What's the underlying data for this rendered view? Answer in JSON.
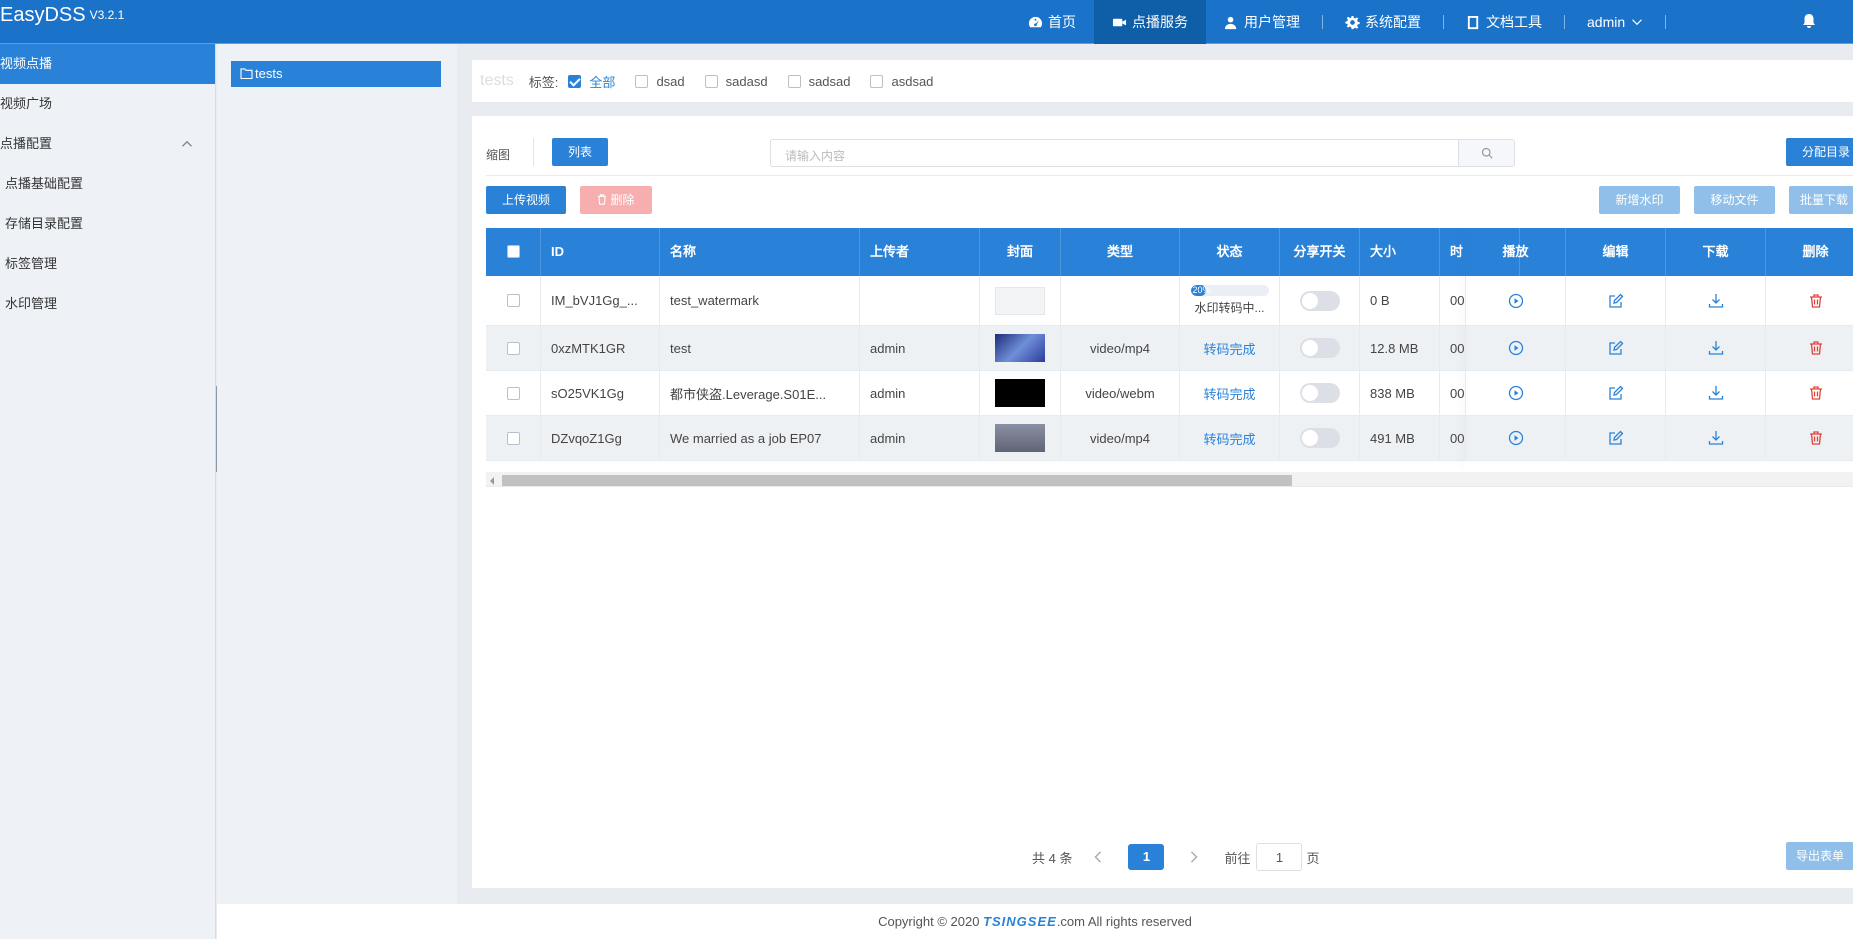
{
  "app": {
    "brand": "EasyDSS",
    "version": "V3.2.1"
  },
  "nav": {
    "home": "首页",
    "vod_service": "点播服务",
    "user_mgmt": "用户管理",
    "sys_config": "系统配置",
    "doc_tools": "文档工具",
    "user": "admin"
  },
  "sidebar": {
    "items": [
      {
        "label": "视频点播"
      },
      {
        "label": "视频广场"
      },
      {
        "label": "点播配置"
      },
      {
        "label": "点播基础配置"
      },
      {
        "label": "存储目录配置"
      },
      {
        "label": "标签管理"
      },
      {
        "label": "水印管理"
      }
    ]
  },
  "folder": {
    "name": "tests"
  },
  "tagbar": {
    "current": "tests",
    "label": "标签:",
    "tags": [
      {
        "label": "全部",
        "checked": true
      },
      {
        "label": "dsad",
        "checked": false
      },
      {
        "label": "sadasd",
        "checked": false
      },
      {
        "label": "sadsad",
        "checked": false
      },
      {
        "label": "asdsad",
        "checked": false
      }
    ]
  },
  "toolbar": {
    "view_thumb": "缩图",
    "view_list": "列表",
    "search_placeholder": "请输入内容",
    "assign_dir": "分配目录",
    "upload": "上传视频",
    "delete": "删除",
    "add_watermark": "新增水印",
    "move_file": "移动文件",
    "batch_download": "批量下载"
  },
  "table": {
    "headers": {
      "id": "ID",
      "name": "名称",
      "uploader": "上传者",
      "cover": "封面",
      "type": "类型",
      "status": "状态",
      "share": "分享开关",
      "size": "大小",
      "time": "时",
      "play": "播放",
      "edit": "编辑",
      "download": "下载",
      "remove": "删除"
    },
    "rows": [
      {
        "id": "IM_bVJ1Gg_...",
        "name": "test_watermark",
        "uploader": "",
        "type": "",
        "status": "水印转码中...",
        "progress": 20,
        "progress_label": "20%",
        "size": "0 B",
        "time": "00",
        "cover": "placeholder",
        "share": false
      },
      {
        "id": "0xzMTK1GR",
        "name": "test",
        "uploader": "admin",
        "type": "video/mp4",
        "status": "转码完成",
        "size": "12.8 MB",
        "time": "00",
        "cover": "blue",
        "share": false
      },
      {
        "id": "sO25VK1Gg",
        "name": "都市侠盗.Leverage.S01E...",
        "uploader": "admin",
        "type": "video/webm",
        "status": "转码完成",
        "size": "838 MB",
        "time": "00",
        "cover": "black",
        "share": false
      },
      {
        "id": "DZvqoZ1Gg",
        "name": "We married as a job EP07",
        "uploader": "admin",
        "type": "video/mp4",
        "status": "转码完成",
        "size": "491 MB",
        "time": "00",
        "cover": "grey",
        "share": false
      }
    ]
  },
  "pagination": {
    "total": "共 4 条",
    "current": "1",
    "goto": "前往",
    "goto_value": "1",
    "page_unit": "页"
  },
  "export": "导出表单",
  "footer": {
    "prefix": "Copyright © 2020 ",
    "logo": "TSINGSEE",
    "suffix": ".com All rights reserved"
  },
  "colors": {
    "primary": "#2a82d8",
    "header": "#1a73c9",
    "danger": "#e0433b"
  }
}
